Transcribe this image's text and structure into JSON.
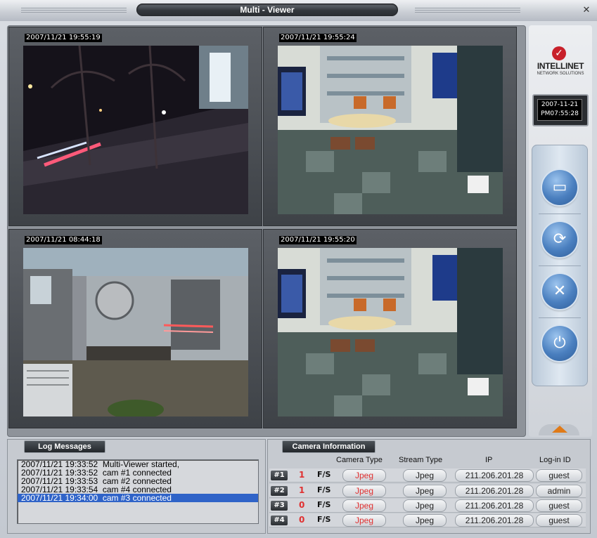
{
  "window": {
    "title": "Multi - Viewer",
    "close": "✕"
  },
  "feeds": [
    {
      "timestamp": "2007/11/21 19:55:19",
      "scene": "street-night"
    },
    {
      "timestamp": "2007/11/21 19:55:24",
      "scene": "shop-interior"
    },
    {
      "timestamp": "2007/11/21 08:44:18",
      "scene": "shop-window"
    },
    {
      "timestamp": "2007/11/21 19:55:20",
      "scene": "shop-interior"
    }
  ],
  "brand": {
    "name": "INTELLINET",
    "tagline": "NETWORK SOLUTIONS"
  },
  "clock": {
    "date": "2007-11-21",
    "time": "PM07:55:28"
  },
  "controls": [
    {
      "name": "open-folder",
      "icon": "folder-icon",
      "glyph": "▭"
    },
    {
      "name": "refresh",
      "icon": "refresh-icon",
      "glyph": "⟳"
    },
    {
      "name": "stop",
      "icon": "close-icon",
      "glyph": "✕"
    },
    {
      "name": "power",
      "icon": "power-icon",
      "glyph": "⏻"
    }
  ],
  "log": {
    "title": "Log Messages",
    "entries": [
      "2007/11/21 19:33:52  Multi-Viewer started,",
      "2007/11/21 19:33:52  cam #1 connected",
      "2007/11/21 19:33:53  cam #2 connected",
      "2007/11/21 19:33:54  cam #4 connected",
      "2007/11/21 19:34:00  cam #3 connected"
    ],
    "selected_index": 4
  },
  "camera_info": {
    "title": "Camera Information",
    "headers": [
      "Camera Type",
      "Stream Type",
      "IP",
      "Log-in ID"
    ],
    "rows": [
      {
        "id": "#1",
        "count": "1",
        "fs": "F/S",
        "camera_type": "Jpeg",
        "stream_type": "Jpeg",
        "ip": "211.206.201.28",
        "login": "guest"
      },
      {
        "id": "#2",
        "count": "1",
        "fs": "F/S",
        "camera_type": "Jpeg",
        "stream_type": "Jpeg",
        "ip": "211.206.201.28",
        "login": "admin"
      },
      {
        "id": "#3",
        "count": "0",
        "fs": "F/S",
        "camera_type": "Jpeg",
        "stream_type": "Jpeg",
        "ip": "211.206.201.28",
        "login": "guest"
      },
      {
        "id": "#4",
        "count": "0",
        "fs": "F/S",
        "camera_type": "Jpeg",
        "stream_type": "Jpeg",
        "ip": "211.206.201.28",
        "login": "guest"
      }
    ]
  },
  "colors": {
    "accent_red": "#e03030",
    "selection": "#2f63c8",
    "button_blue": "#4a7fbf"
  }
}
